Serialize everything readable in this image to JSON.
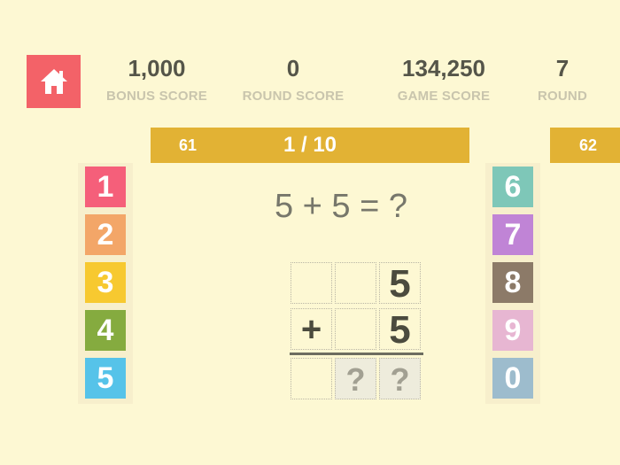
{
  "header": {
    "home_icon": "home-icon",
    "stats": [
      {
        "value": "1,000",
        "label": "BONUS SCORE"
      },
      {
        "value": "0",
        "label": "ROUND SCORE"
      },
      {
        "value": "134,250",
        "label": "GAME SCORE"
      },
      {
        "value": "7",
        "label": "ROUND"
      }
    ]
  },
  "level_bar": {
    "prev_level": "61",
    "progress": "1 / 10",
    "next_level": "62"
  },
  "keypad_left": [
    {
      "label": "1",
      "color": "#f55f7a"
    },
    {
      "label": "2",
      "color": "#f3a668"
    },
    {
      "label": "3",
      "color": "#f7c930"
    },
    {
      "label": "4",
      "color": "#85ab3f"
    },
    {
      "label": "5",
      "color": "#56c3e9"
    }
  ],
  "keypad_right": [
    {
      "label": "6",
      "color": "#7ec7b8"
    },
    {
      "label": "7",
      "color": "#c084d6"
    },
    {
      "label": "8",
      "color": "#8c7a68"
    },
    {
      "label": "9",
      "color": "#e7b6d2"
    },
    {
      "label": "0",
      "color": "#9dbccd"
    }
  ],
  "problem": {
    "equation": "5 + 5 = ?",
    "row1": [
      "",
      "",
      "5"
    ],
    "row2": [
      "+",
      "",
      "5"
    ],
    "answer": [
      "",
      "?",
      "?"
    ]
  }
}
